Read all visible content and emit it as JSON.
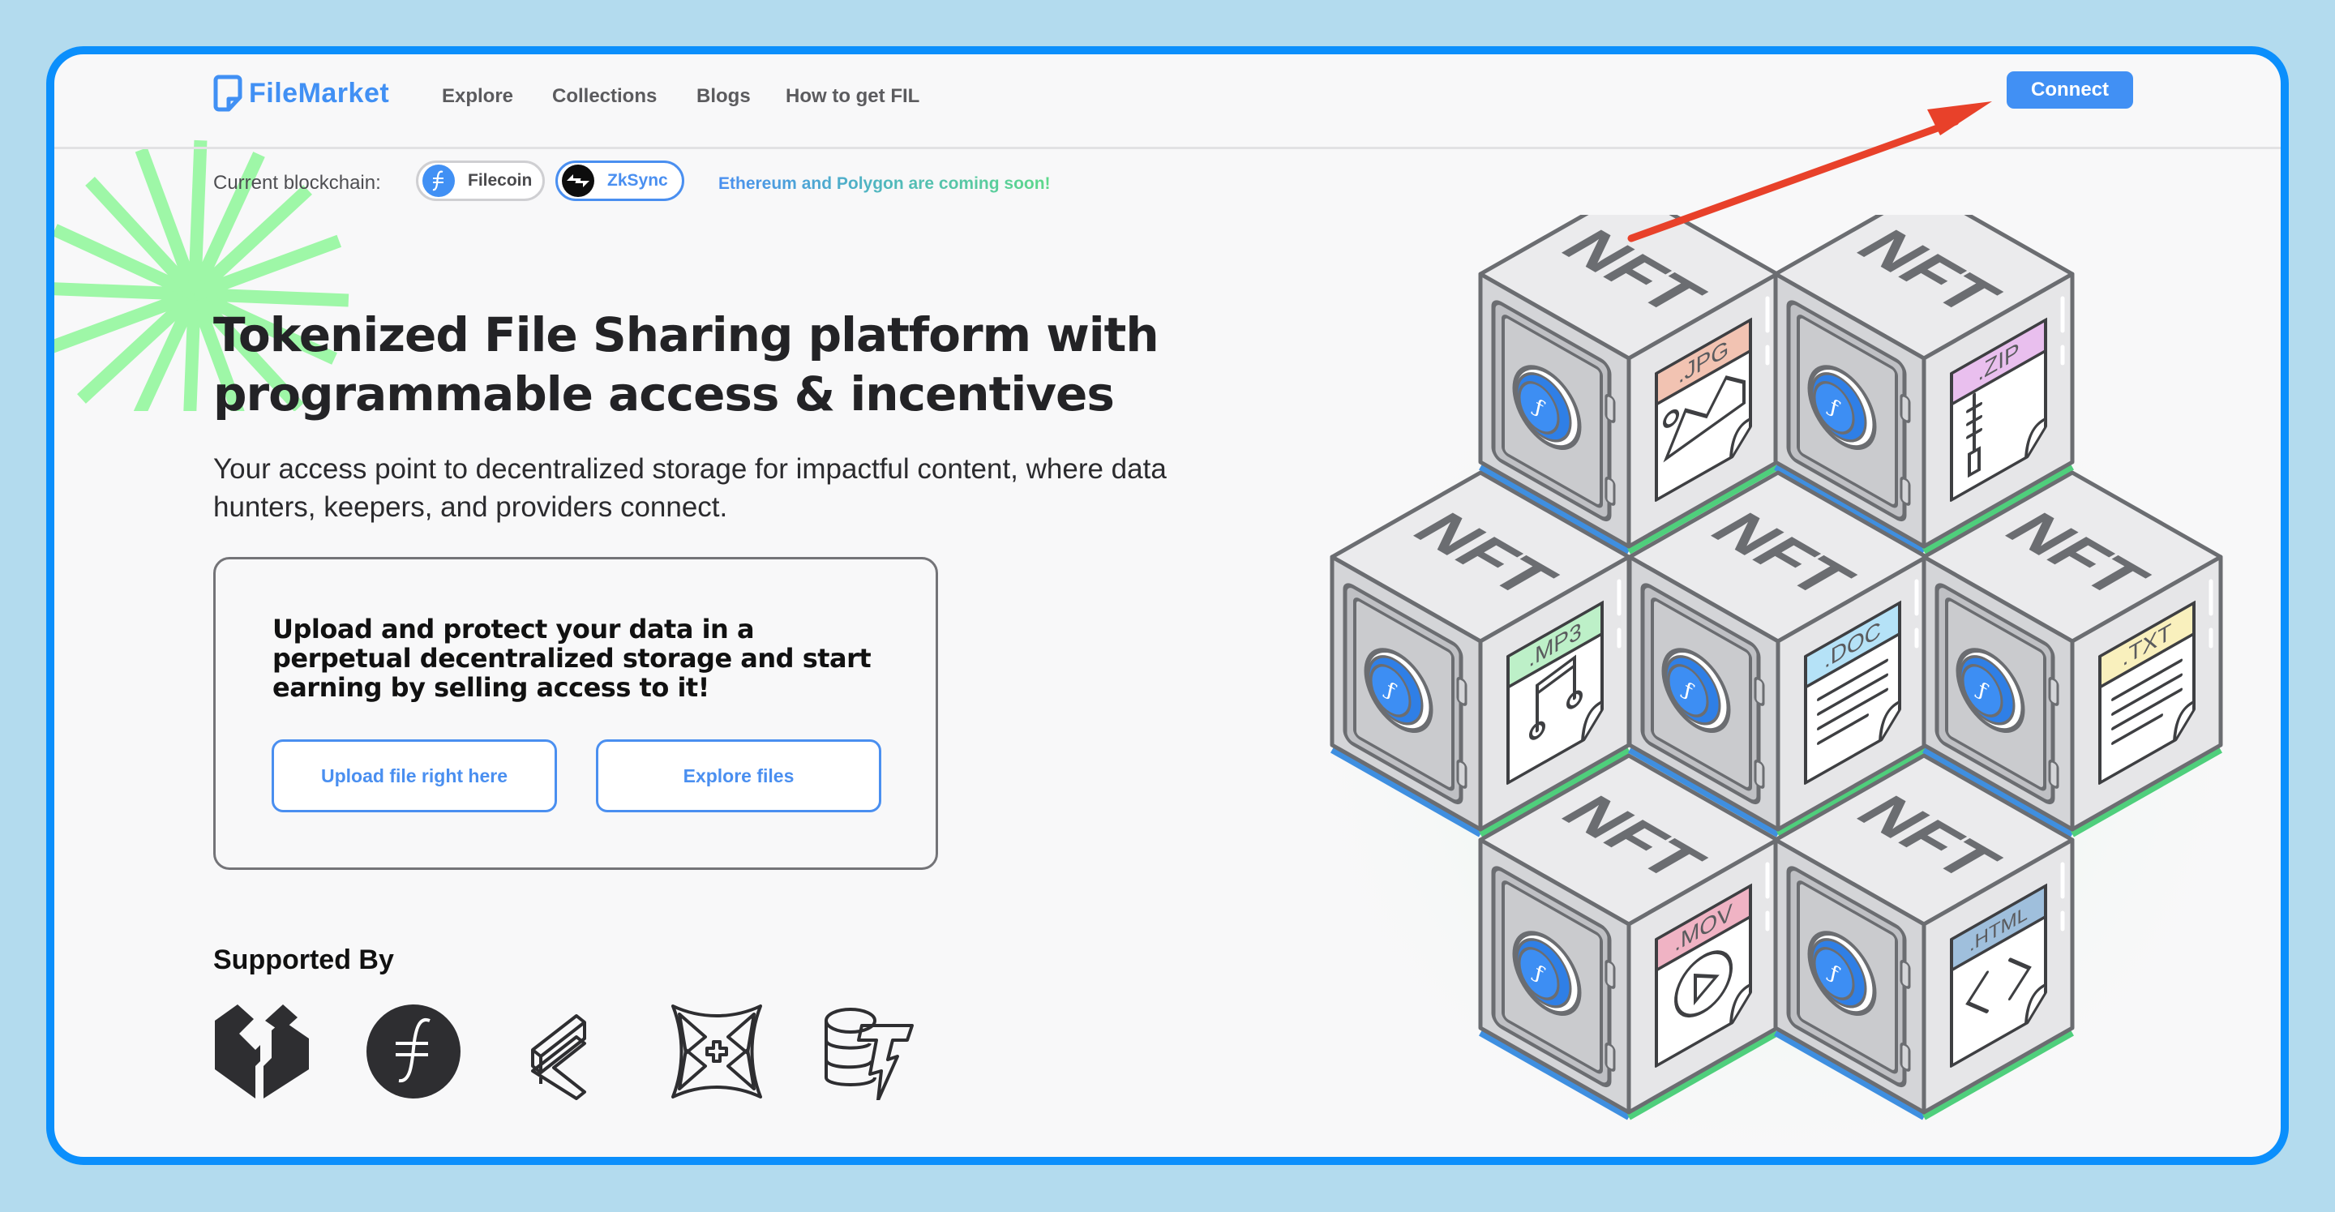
{
  "header": {
    "brand": "FileMarket",
    "nav": [
      {
        "label": "Explore"
      },
      {
        "label": "Collections"
      },
      {
        "label": "Blogs"
      },
      {
        "label": "How to get FIL"
      }
    ],
    "connect_label": "Connect"
  },
  "chain_bar": {
    "label": "Current blockchain:",
    "chains": [
      {
        "name": "Filecoin",
        "icon": "filecoin-icon",
        "selected": false
      },
      {
        "name": "ZkSync",
        "icon": "zksync-icon",
        "selected": true
      }
    ],
    "notice": "Ethereum and Polygon are coming soon!"
  },
  "hero": {
    "title": "Tokenized File Sharing platform with programmable access & incentives",
    "subtitle": "Your access point to decentralized storage for impactful content, where data hunters, keepers, and providers connect."
  },
  "cta_card": {
    "text": "Upload and protect your data in a perpetual decentralized storage and start earning by selling access to it!",
    "upload_label": "Upload file right here",
    "explore_label": "Explore files"
  },
  "supported": {
    "title": "Supported By",
    "logos": [
      "sponsor-cube-logo",
      "filecoin-logo",
      "zigzag-blocks-logo",
      "x-sigil-logo",
      "database-bolt-logo"
    ]
  },
  "illustration": {
    "cube_label": "NFT",
    "files": [
      {
        "ext": ".JPG",
        "color": "#f2c3b2",
        "glyph": "image"
      },
      {
        "ext": ".ZIP",
        "color": "#e9bfee",
        "glyph": "zip"
      },
      {
        "ext": ".MP3",
        "color": "#bdf0c8",
        "glyph": "music"
      },
      {
        "ext": ".DOC",
        "color": "#b5e2f7",
        "glyph": "doc"
      },
      {
        "ext": ".TXT",
        "color": "#f9f0bd",
        "glyph": "doc"
      },
      {
        "ext": ".MOV",
        "color": "#f0b3c4",
        "glyph": "play"
      },
      {
        "ext": ".HTML",
        "color": "#9fbfdc",
        "glyph": "code"
      }
    ]
  },
  "colors": {
    "accent": "#4190f4",
    "frame_border": "#0b8ffc",
    "backdrop": "#b3dbee",
    "star": "#9ef7a7",
    "annotation_arrow": "#e8412a"
  }
}
